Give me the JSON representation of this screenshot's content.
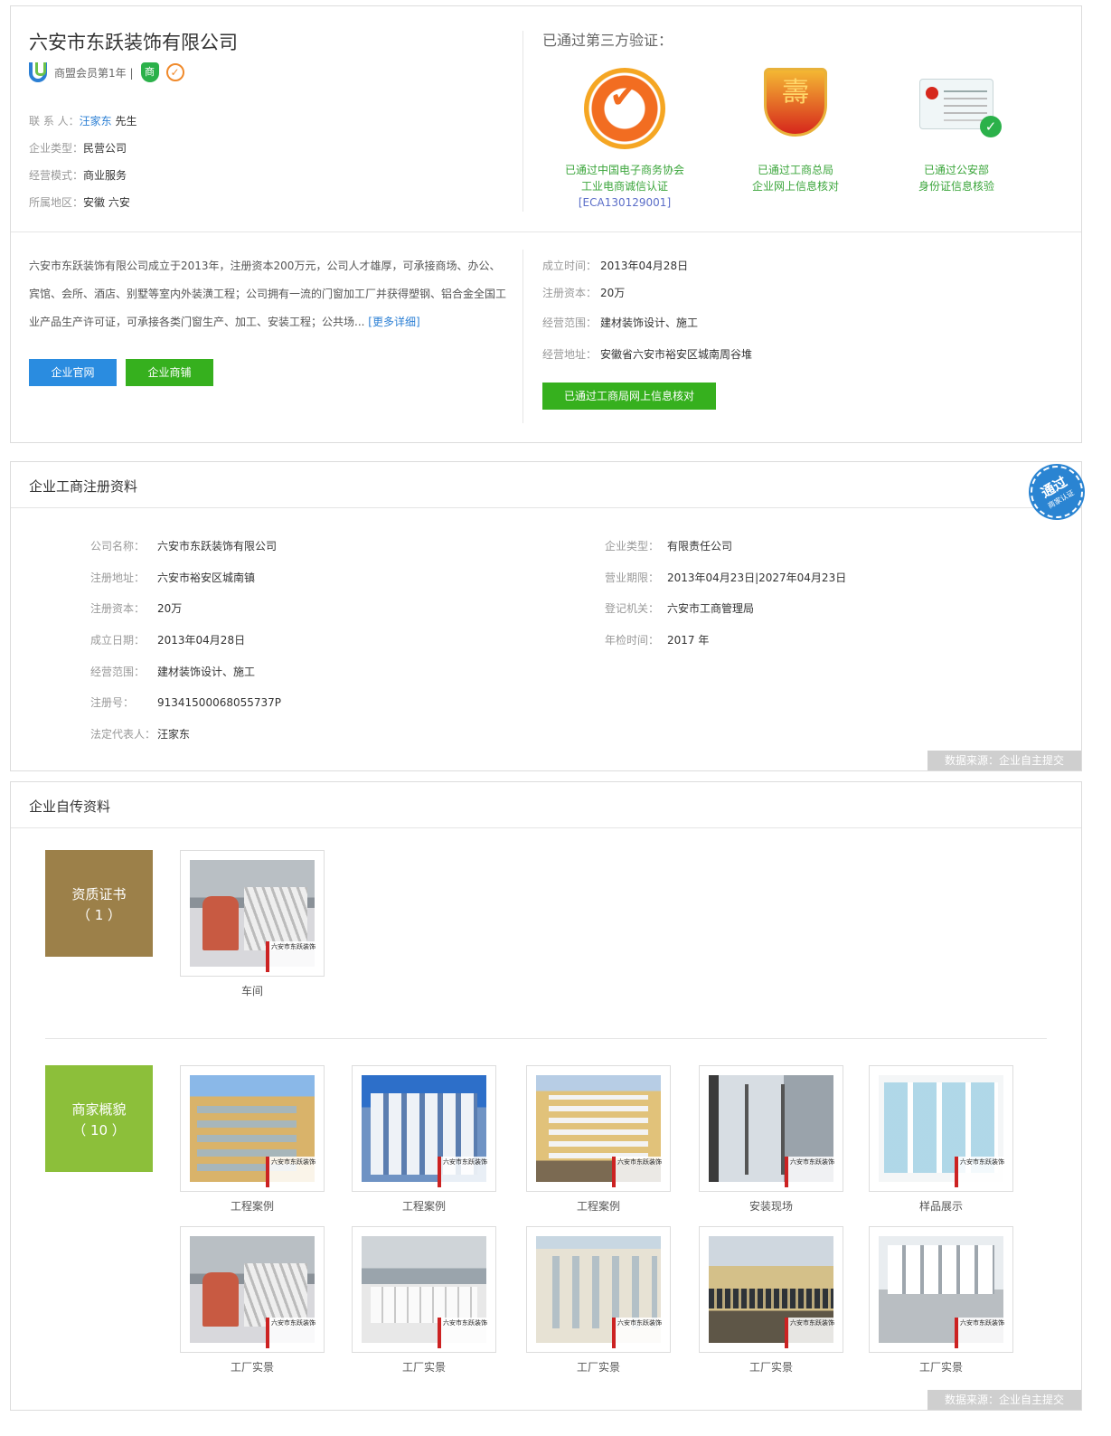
{
  "company": {
    "name": "六安市东跃装饰有限公司",
    "member_label": "商盟会员第1年 |",
    "badge_shang": "商",
    "badge_check": "✓"
  },
  "contact": {
    "contact_label": "联 系 人：",
    "contact_name": "汪家东",
    "contact_title": " 先生",
    "type_label": "企业类型：",
    "type_value": "民营公司",
    "mode_label": "经营模式：",
    "mode_value": "商业服务",
    "region_label": "所属地区：",
    "region_value": "安徽 六安"
  },
  "verification": {
    "title": "已通过第三方验证：",
    "badges": [
      {
        "line1": "已通过中国电子商务协会",
        "line2": "工业电商诚信认证",
        "code": "[ECA130129001]"
      },
      {
        "line1": "已通过工商总局",
        "line2": "企业网上信息核对",
        "code": ""
      },
      {
        "line1": "已通过公安部",
        "line2": "身份证信息核验",
        "code": ""
      }
    ]
  },
  "intro": {
    "text": "六安市东跃装饰有限公司成立于2013年，注册资本200万元，公司人才雄厚，可承接商场、办公、宾馆、会所、酒店、别墅等室内外装潢工程；公司拥有一流的门窗加工厂并获得塑钢、铝合金全国工业产品生产许可证，可承接各类门窗生产、加工、安装工程；公共场... ",
    "more": "[更多详细]",
    "btn_site": "企业官网",
    "btn_shop": "企业商铺"
  },
  "summary": {
    "rows": [
      {
        "label": "成立时间：",
        "value": "2013年04月28日"
      },
      {
        "label": "注册资本：",
        "value": "20万"
      },
      {
        "label": "经营范围：",
        "value": "建材装饰设计、施工"
      },
      {
        "label": "经营地址：",
        "value": "安徽省六安市裕安区城南周谷堆"
      }
    ],
    "btn_verified": "已通过工商局网上信息核对"
  },
  "registration": {
    "title": "企业工商注册资料",
    "pass_big": "通过",
    "pass_small": "商家认证",
    "left": [
      {
        "label": "公司名称：",
        "value": "六安市东跃装饰有限公司"
      },
      {
        "label": "注册地址：",
        "value": "六安市裕安区城南镇"
      },
      {
        "label": "注册资本：",
        "value": "20万"
      },
      {
        "label": "成立日期：",
        "value": "2013年04月28日"
      },
      {
        "label": "经营范围：",
        "value": "建材装饰设计、施工"
      },
      {
        "label": "注册号：",
        "value": "91341500068055737P"
      },
      {
        "label": "法定代表人：",
        "value": "汪家东"
      }
    ],
    "right": [
      {
        "label": "企业类型：",
        "value": "有限责任公司"
      },
      {
        "label": "营业期限：",
        "value": "2013年04月23日|2027年04月23日"
      },
      {
        "label": "登记机关：",
        "value": "六安市工商管理局"
      },
      {
        "label": "年检时间：",
        "value": "2017 年"
      }
    ],
    "source": "数据来源：企业自主提交"
  },
  "profile": {
    "title": "企业自传资料",
    "cert_label": "资质证书",
    "cert_count": "（ 1 ）",
    "cert_items": [
      {
        "caption": "车间"
      }
    ],
    "overview_label": "商家概貌",
    "overview_count": "（ 10 ）",
    "overview_items": [
      {
        "caption": "工程案例"
      },
      {
        "caption": "工程案例"
      },
      {
        "caption": "工程案例"
      },
      {
        "caption": "安装现场"
      },
      {
        "caption": "样品展示"
      },
      {
        "caption": "工厂实景"
      },
      {
        "caption": "工厂实景"
      },
      {
        "caption": "工厂实景"
      },
      {
        "caption": "工厂实景"
      },
      {
        "caption": "工厂实景"
      }
    ],
    "watermark": "六安市东跃装饰",
    "source": "数据来源：企业自主提交"
  }
}
